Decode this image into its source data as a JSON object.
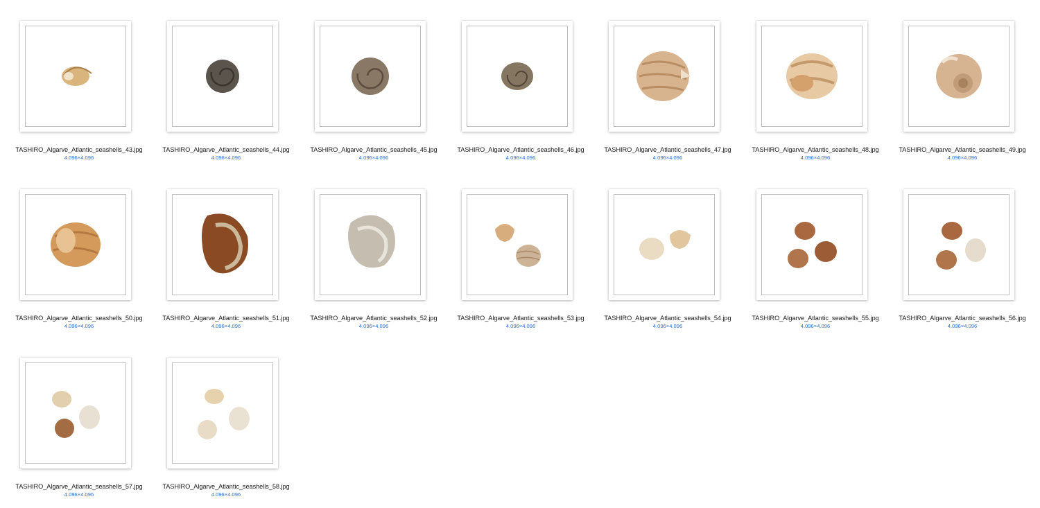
{
  "colors": {
    "filename_text": "#1a1a1a",
    "dimensions_text": "#2f6fce",
    "frame_border": "#bfbfbf",
    "background": "#ffffff"
  },
  "files": [
    {
      "name": "TASHIRO_Algarve_Atlantic_seashells_43.jpg",
      "dims": "4.096×4.096",
      "icon": "seashell-thumbnail-icon"
    },
    {
      "name": "TASHIRO_Algarve_Atlantic_seashells_44.jpg",
      "dims": "4.096×4.096",
      "icon": "seashell-thumbnail-icon"
    },
    {
      "name": "TASHIRO_Algarve_Atlantic_seashells_45.jpg",
      "dims": "4.096×4.096",
      "icon": "seashell-thumbnail-icon"
    },
    {
      "name": "TASHIRO_Algarve_Atlantic_seashells_46.jpg",
      "dims": "4.096×4.096",
      "icon": "seashell-thumbnail-icon"
    },
    {
      "name": "TASHIRO_Algarve_Atlantic_seashells_47.jpg",
      "dims": "4.096×4.096",
      "icon": "seashell-thumbnail-icon"
    },
    {
      "name": "TASHIRO_Algarve_Atlantic_seashells_48.jpg",
      "dims": "4.096×4.096",
      "icon": "seashell-thumbnail-icon"
    },
    {
      "name": "TASHIRO_Algarve_Atlantic_seashells_49.jpg",
      "dims": "4.096×4.096",
      "icon": "seashell-thumbnail-icon"
    },
    {
      "name": "TASHIRO_Algarve_Atlantic_seashells_50.jpg",
      "dims": "4.096×4.096",
      "icon": "seashell-thumbnail-icon"
    },
    {
      "name": "TASHIRO_Algarve_Atlantic_seashells_51.jpg",
      "dims": "4.096×4.096",
      "icon": "seashell-thumbnail-icon"
    },
    {
      "name": "TASHIRO_Algarve_Atlantic_seashells_52.jpg",
      "dims": "4.096×4.096",
      "icon": "seashell-thumbnail-icon"
    },
    {
      "name": "TASHIRO_Algarve_Atlantic_seashells_53.jpg",
      "dims": "4.096×4.096",
      "icon": "seashell-thumbnail-icon"
    },
    {
      "name": "TASHIRO_Algarve_Atlantic_seashells_54.jpg",
      "dims": "4.096×4.096",
      "icon": "seashell-thumbnail-icon"
    },
    {
      "name": "TASHIRO_Algarve_Atlantic_seashells_55.jpg",
      "dims": "4.096×4.096",
      "icon": "seashell-thumbnail-icon"
    },
    {
      "name": "TASHIRO_Algarve_Atlantic_seashells_56.jpg",
      "dims": "4.096×4.096",
      "icon": "seashell-thumbnail-icon"
    },
    {
      "name": "TASHIRO_Algarve_Atlantic_seashells_57.jpg",
      "dims": "4.096×4.096",
      "icon": "seashell-thumbnail-icon"
    },
    {
      "name": "TASHIRO_Algarve_Atlantic_seashells_58.jpg",
      "dims": "4.096×4.096",
      "icon": "seashell-thumbnail-icon"
    }
  ]
}
